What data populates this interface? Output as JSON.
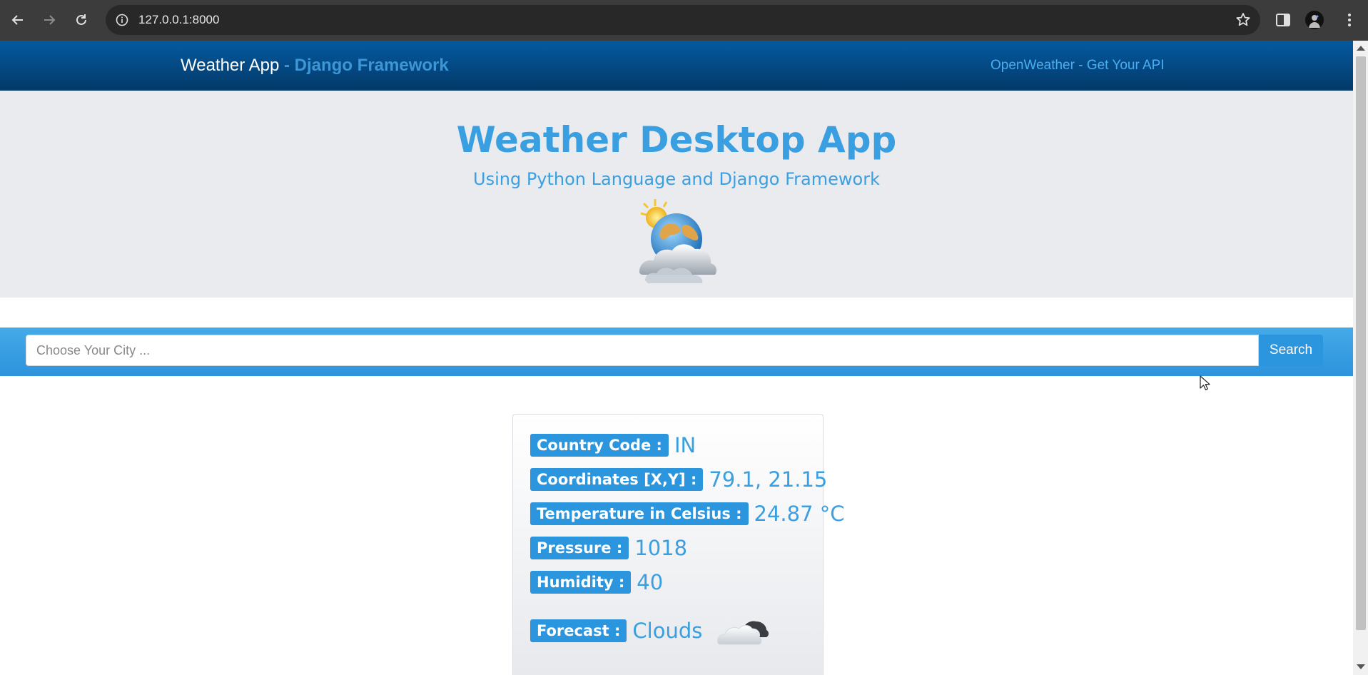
{
  "browser": {
    "url": "127.0.0.1:8000"
  },
  "navbar": {
    "brand": "Weather App",
    "brand_accent": "- Django Framework",
    "api_link": "OpenWeather - Get Your API"
  },
  "hero": {
    "title": "Weather Desktop App",
    "subtitle": "Using Python Language and Django Framework",
    "image_icon": "sun-globe-clouds-icon"
  },
  "search": {
    "placeholder": "Choose Your City ...",
    "value": "",
    "button_label": "Search"
  },
  "weather": {
    "country_code": {
      "label": "Country Code :",
      "value": "IN"
    },
    "coordinates": {
      "label": "Coordinates [X,Y] :",
      "value": "79.1, 21.15"
    },
    "temperature": {
      "label": "Temperature in Celsius :",
      "value": "24.87 °C"
    },
    "pressure": {
      "label": "Pressure :",
      "value": "1018"
    },
    "humidity": {
      "label": "Humidity :",
      "value": "40"
    },
    "forecast": {
      "label": "Forecast :",
      "value": "Clouds",
      "icon": "clouds-icon"
    }
  },
  "colors": {
    "navbar": "#033968",
    "accent": "#3a9fe0",
    "badge": "#2b95dd",
    "jumbotron": "#e9ebef"
  }
}
